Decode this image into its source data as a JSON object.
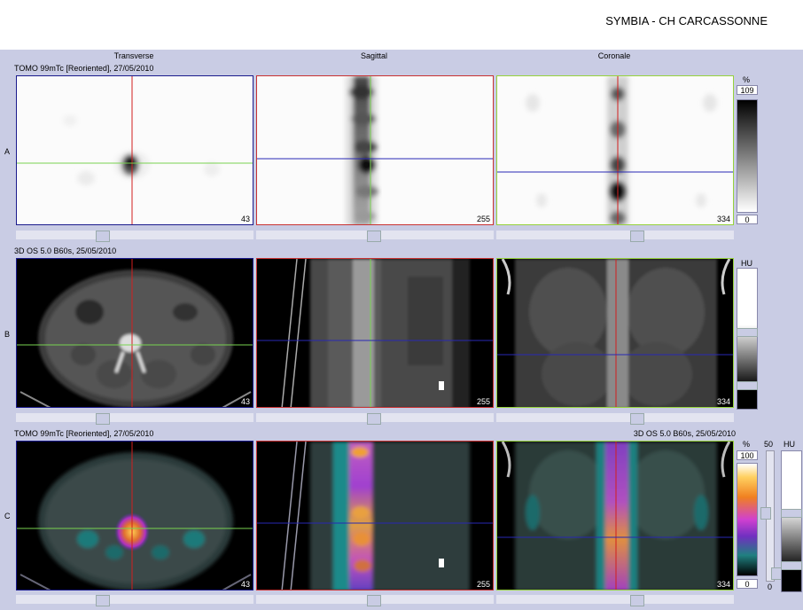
{
  "header": {
    "title": "SYMBIA - CH CARCASSONNE"
  },
  "columns": [
    "Transverse",
    "Sagittal",
    "Coronale"
  ],
  "rows": [
    {
      "label": "A",
      "series": "TOMO 99mTc [Reoriented], 27/05/2010",
      "series_right": "",
      "slices": [
        "43",
        "255",
        "334"
      ]
    },
    {
      "label": "B",
      "series": "3D  OS  5.0  B60s, 25/05/2010",
      "series_right": "",
      "slices": [
        "43",
        "255",
        "334"
      ]
    },
    {
      "label": "C",
      "series": "TOMO 99mTc [Reoriented], 27/05/2010",
      "series_right": "3D  OS  5.0  B60s, 25/05/2010",
      "slices": [
        "43",
        "255",
        "334"
      ]
    }
  ],
  "scales": {
    "a": {
      "unit": "%",
      "max": "109",
      "min": "0"
    },
    "b": {
      "unit": "HU"
    },
    "c": {
      "unit": "%",
      "max": "100",
      "min": "0",
      "blend_max": "50",
      "blend_min": "0",
      "ct_unit": "HU"
    }
  },
  "colors": {
    "transverse_frame": "#1a1a8c",
    "sagittal_frame": "#c83232",
    "coronal_frame": "#96d23c",
    "crosshair_red": "#d21e1e",
    "crosshair_green": "#78d250",
    "crosshair_blue": "#2828b4"
  }
}
